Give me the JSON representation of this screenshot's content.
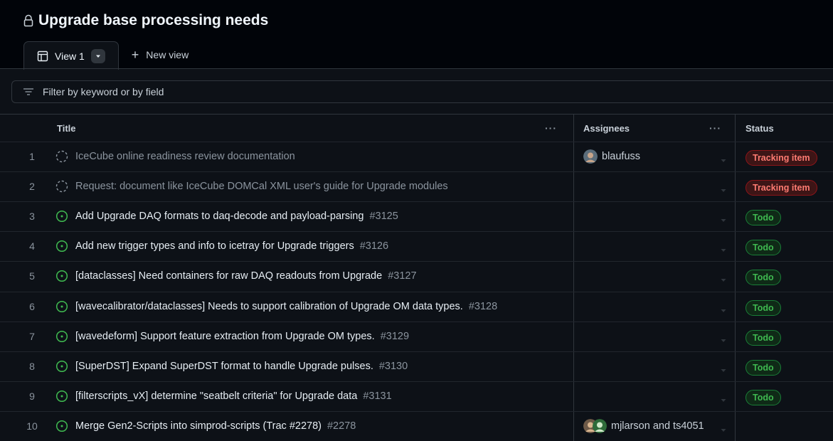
{
  "project": {
    "title": "Upgrade base processing needs"
  },
  "tabs": {
    "active_label": "View 1",
    "new_view_label": "New view"
  },
  "filter": {
    "placeholder": "Filter by keyword or by field"
  },
  "columns": {
    "title": "Title",
    "assignees": "Assignees",
    "status": "Status"
  },
  "rows": [
    {
      "num": "1",
      "kind": "draft",
      "title": "IceCube online readiness review documentation",
      "issue": "",
      "assignee": "blaufuss",
      "avatars": 1,
      "status": "Tracking item",
      "status_color": "red"
    },
    {
      "num": "2",
      "kind": "draft",
      "title": "Request: document like IceCube DOMCal XML user's guide for Upgrade modules",
      "issue": "",
      "assignee": "",
      "avatars": 0,
      "status": "Tracking item",
      "status_color": "red"
    },
    {
      "num": "3",
      "kind": "issue",
      "title": "Add Upgrade DAQ formats to daq-decode and payload-parsing",
      "issue": "#3125",
      "assignee": "",
      "avatars": 0,
      "status": "Todo",
      "status_color": "green"
    },
    {
      "num": "4",
      "kind": "issue",
      "title": "Add new trigger types and info to icetray for Upgrade triggers",
      "issue": "#3126",
      "assignee": "",
      "avatars": 0,
      "status": "Todo",
      "status_color": "green"
    },
    {
      "num": "5",
      "kind": "issue",
      "title": "[dataclasses] Need containers for raw DAQ readouts from Upgrade",
      "issue": "#3127",
      "assignee": "",
      "avatars": 0,
      "status": "Todo",
      "status_color": "green"
    },
    {
      "num": "6",
      "kind": "issue",
      "title": "[wavecalibrator/dataclasses] Needs to support calibration of Upgrade OM data types.",
      "issue": "#3128",
      "assignee": "",
      "avatars": 0,
      "status": "Todo",
      "status_color": "green"
    },
    {
      "num": "7",
      "kind": "issue",
      "title": "[wavedeform] Support feature extraction from Upgrade OM types.",
      "issue": "#3129",
      "assignee": "",
      "avatars": 0,
      "status": "Todo",
      "status_color": "green"
    },
    {
      "num": "8",
      "kind": "issue",
      "title": "[SuperDST] Expand SuperDST format to handle Upgrade pulses.",
      "issue": "#3130",
      "assignee": "",
      "avatars": 0,
      "status": "Todo",
      "status_color": "green"
    },
    {
      "num": "9",
      "kind": "issue",
      "title": "[filterscripts_vX] determine \"seatbelt criteria\" for Upgrade data",
      "issue": "#3131",
      "assignee": "",
      "avatars": 0,
      "status": "Todo",
      "status_color": "green"
    },
    {
      "num": "10",
      "kind": "issue",
      "title": "Merge Gen2-Scripts into simprod-scripts (Trac #2278)",
      "issue": "#2278",
      "assignee": "mjlarson and ts4051",
      "avatars": 2,
      "status": "",
      "status_color": ""
    }
  ],
  "colors": {
    "background": "#0d1117",
    "header_bg": "#010409",
    "border": "#30363d",
    "open_issue_green": "#3fb950",
    "tracking_red": "#ff7b72"
  },
  "icons": {
    "lock": "lock-icon",
    "table": "table-view-icon",
    "dropdown": "triangle-down-icon",
    "plus": "plus-icon",
    "filter": "filter-icon",
    "draft": "draft-issue-icon",
    "open_issue": "issue-opened-icon",
    "more": "kebab-horizontal-icon"
  }
}
